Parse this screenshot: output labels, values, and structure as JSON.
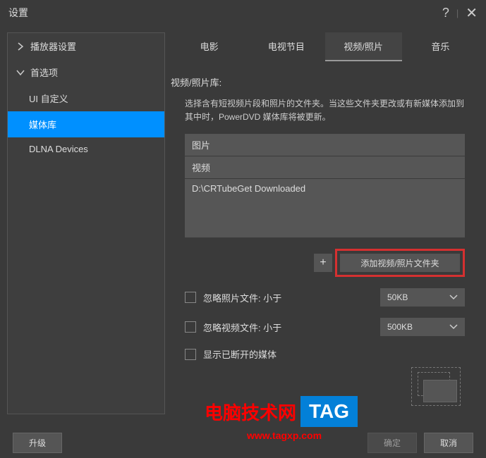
{
  "window": {
    "title": "设置"
  },
  "sidebar": {
    "items": [
      {
        "label": "播放器设置",
        "expanded": false
      },
      {
        "label": "首选项",
        "expanded": true
      },
      {
        "label": "UI 自定义"
      },
      {
        "label": "媒体库",
        "active": true
      },
      {
        "label": "DLNA Devices"
      }
    ]
  },
  "tabs": [
    {
      "label": "电影"
    },
    {
      "label": "电视节目"
    },
    {
      "label": "视频/照片",
      "active": true
    },
    {
      "label": "音乐"
    }
  ],
  "content": {
    "section_title": "视频/照片库:",
    "description": "选择含有短视频片段和照片的文件夹。当这些文件夹更改或有新媒体添加到其中时，PowerDVD 媒体库将被更新。",
    "folders": [
      "图片",
      "视频",
      "D:\\CRTubeGet Downloaded"
    ],
    "add_button": "添加视频/照片文件夹",
    "options": {
      "ignore_photo_label": "忽略照片文件: 小于",
      "ignore_photo_value": "50KB",
      "ignore_video_label": "忽略视频文件: 小于",
      "ignore_video_value": "500KB",
      "show_disconnected": "显示已断开的媒体"
    }
  },
  "footer": {
    "upgrade": "升级",
    "confirm": "确定",
    "cancel": "取消"
  },
  "watermark": {
    "text": "电脑技术网",
    "tag": "TAG",
    "url": "www.tagxp.com"
  }
}
